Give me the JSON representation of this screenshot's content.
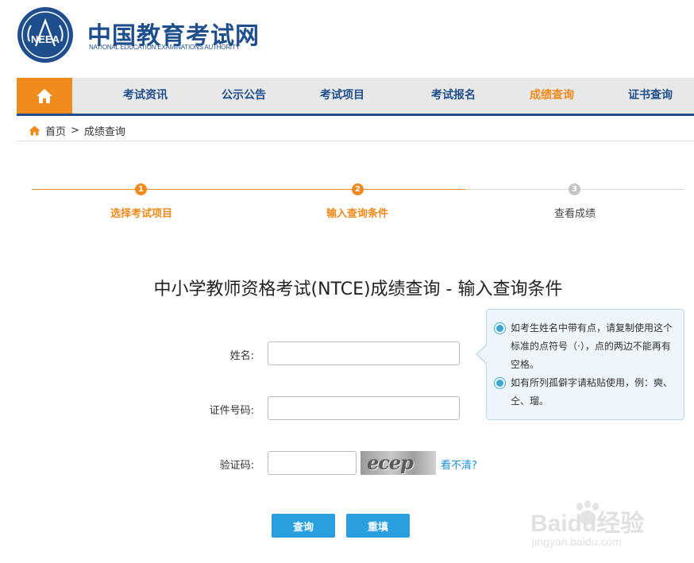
{
  "header": {
    "title": "中国教育考试网",
    "subtitle": "NATIONAL EDUCATION EXAMINATIONS AUTHORITY",
    "seal_text": "NEEA"
  },
  "nav": {
    "items": [
      {
        "label": "考试资讯"
      },
      {
        "label": "公示公告"
      },
      {
        "label": "考试项目"
      },
      {
        "label": "考试报名"
      },
      {
        "label": "成绩查询"
      },
      {
        "label": "证书查询"
      }
    ],
    "active_index": 4
  },
  "breadcrumb": {
    "home": "首页",
    "separator": ">",
    "current": "成绩查询"
  },
  "steps": [
    {
      "number": "1",
      "label": "选择考试项目",
      "state": "done"
    },
    {
      "number": "2",
      "label": "输入查询条件",
      "state": "done"
    },
    {
      "number": "3",
      "label": "查看成绩",
      "state": "todo"
    }
  ],
  "form": {
    "title": "中小学教师资格考试(NTCE)成绩查询 - 输入查询条件",
    "name_label": "姓名:",
    "name_value": "",
    "id_label": "证件号码:",
    "id_value": "",
    "captcha_label": "验证码:",
    "captcha_value": "",
    "captcha_image_text": "ecep",
    "captcha_refresh": "看不清?",
    "submit_label": "查询",
    "reset_label": "重填"
  },
  "tip": {
    "items": [
      "如考生姓名中带有点，请复制使用这个标准的点符号（·），点的两边不能再有空格。",
      "如有所列孤僻字请粘贴使用，例：奭、仝、瑠。"
    ]
  },
  "watermark": {
    "brand": "Baidu经验",
    "url": "jingyan.baidu.com"
  },
  "colors": {
    "brand_blue": "#1f4e8c",
    "accent_orange": "#f08a1c",
    "button_blue": "#2a9fe0",
    "link_blue": "#1a8fd6"
  }
}
